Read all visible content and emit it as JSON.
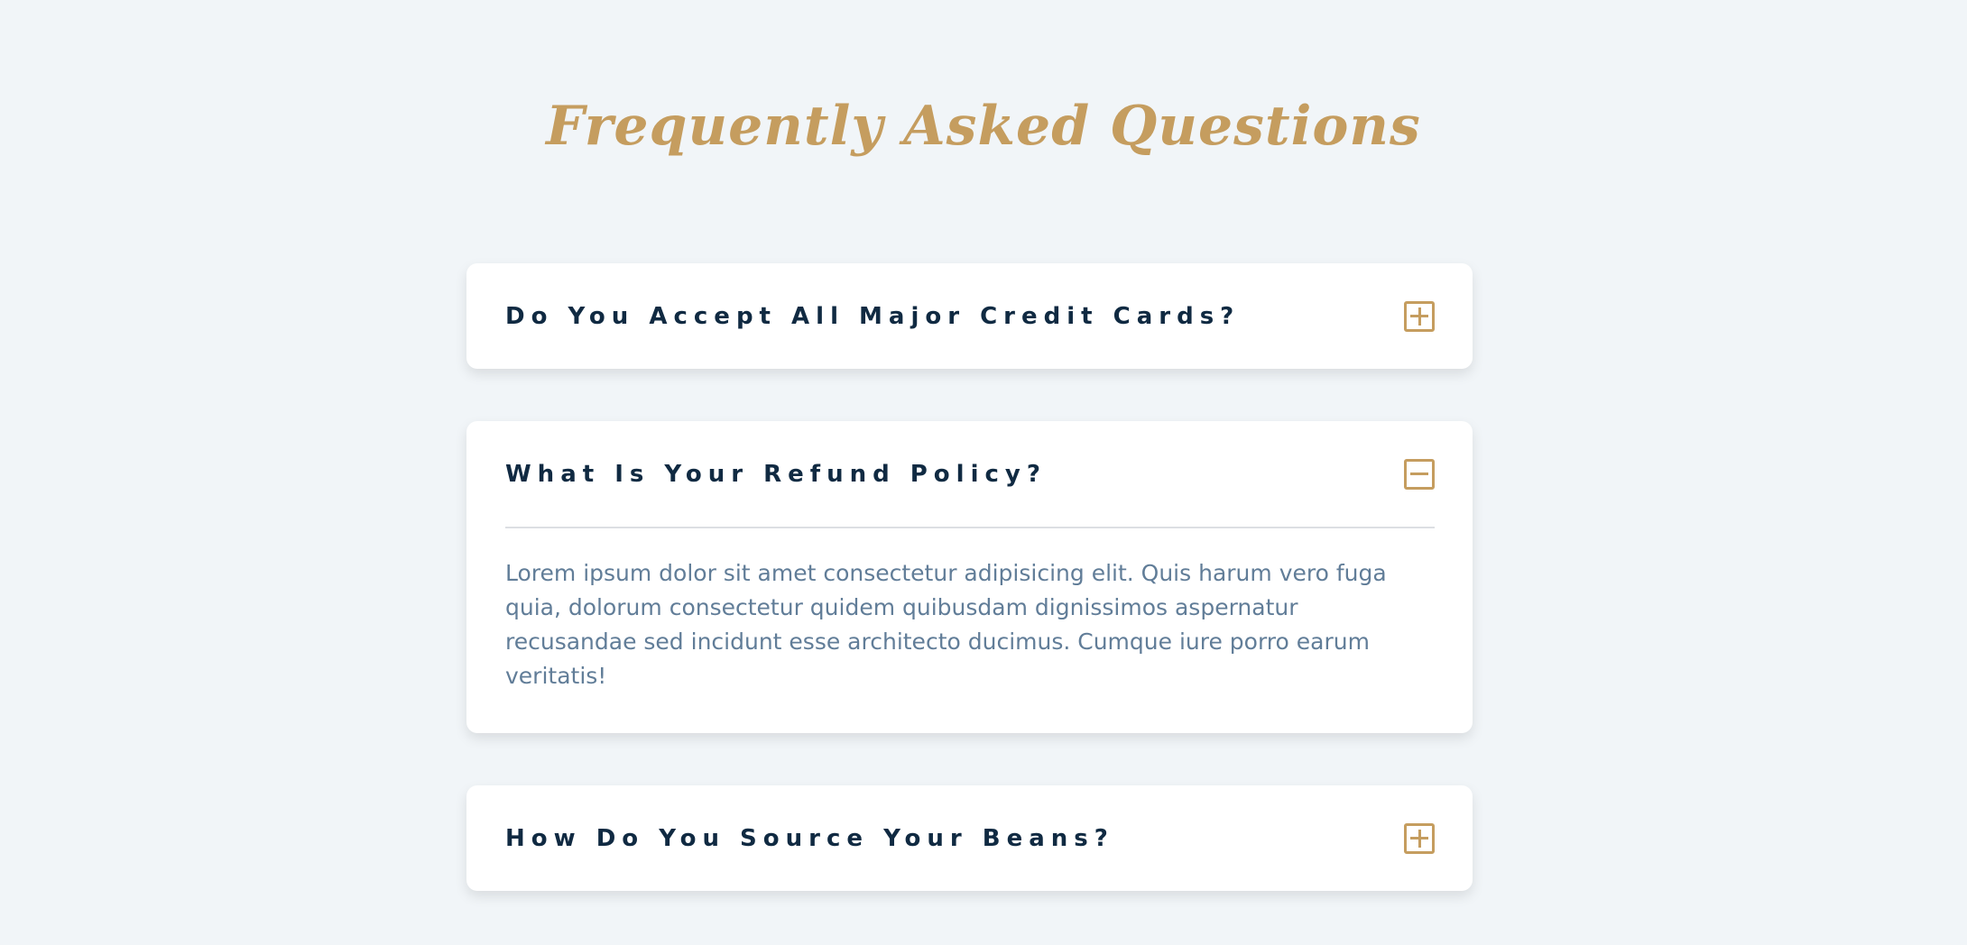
{
  "page": {
    "title": "Frequently Asked Questions"
  },
  "faq": {
    "items": [
      {
        "question": "Do You Accept All Major Credit Cards?",
        "expanded": false,
        "icon": "plus-square-icon"
      },
      {
        "question": "What Is Your Refund Policy?",
        "expanded": true,
        "icon": "minus-square-icon",
        "answer": "Lorem ipsum dolor sit amet consectetur adipisicing elit. Quis harum vero fuga quia, dolorum consectetur quidem quibusdam dignissimos aspernatur recusandae sed incidunt esse architecto ducimus. Cumque iure porro earum veritatis!"
      },
      {
        "question": "How Do You Source Your Beans?",
        "expanded": false,
        "icon": "plus-square-icon"
      }
    ]
  },
  "colors": {
    "background": "#f1f5f8",
    "accent": "#c59d5f",
    "question_text": "#102a42",
    "answer_text": "#617d98",
    "card": "#ffffff"
  }
}
